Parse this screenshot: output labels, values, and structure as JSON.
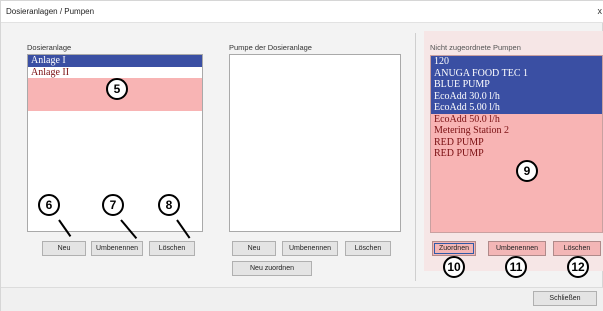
{
  "window": {
    "title": "Dosieranlagen / Pumpen",
    "close_glyph": "x"
  },
  "left": {
    "label": "Dosieranlage",
    "items": [
      {
        "text": "Anlage I",
        "selected": true
      },
      {
        "text": "Anlage II",
        "selected": false
      }
    ],
    "buttons": {
      "new": "Neu",
      "rename": "Umbenennen",
      "delete": "Löschen"
    }
  },
  "middle": {
    "label": "Pumpe der Dosieranlage",
    "buttons": {
      "new": "Neu",
      "rename": "Umbenennen",
      "delete": "Löschen",
      "assign_new": "Neu zuordnen"
    }
  },
  "right": {
    "label": "Nicht zugeordnete Pumpen",
    "items": [
      {
        "text": "120",
        "selected": true
      },
      {
        "text": "ANUGA FOOD TEC 1",
        "selected": true
      },
      {
        "text": "BLUE PUMP",
        "selected": true
      },
      {
        "text": "EcoAdd 30.0 l/h",
        "selected": true
      },
      {
        "text": "EcoAdd 5.00 l/h",
        "selected": true
      },
      {
        "text": "EcoAdd 50.0 l/h",
        "selected": false
      },
      {
        "text": "Metering Station 2",
        "selected": false
      },
      {
        "text": "RED PUMP",
        "selected": false
      },
      {
        "text": "RED PUMP",
        "selected": false
      }
    ],
    "buttons": {
      "assign": "Zuordnen",
      "rename": "Umbenennen",
      "delete": "Löschen"
    }
  },
  "footer": {
    "close": "Schließen"
  },
  "callouts": {
    "c5": "5",
    "c6": "6",
    "c7": "7",
    "c8": "8",
    "c9": "9",
    "c10": "10",
    "c11": "11",
    "c12": "12"
  },
  "colors": {
    "selection": "#3a4fa3",
    "pink_highlight": "#f8b4b4",
    "item_text": "#7a0f12"
  }
}
